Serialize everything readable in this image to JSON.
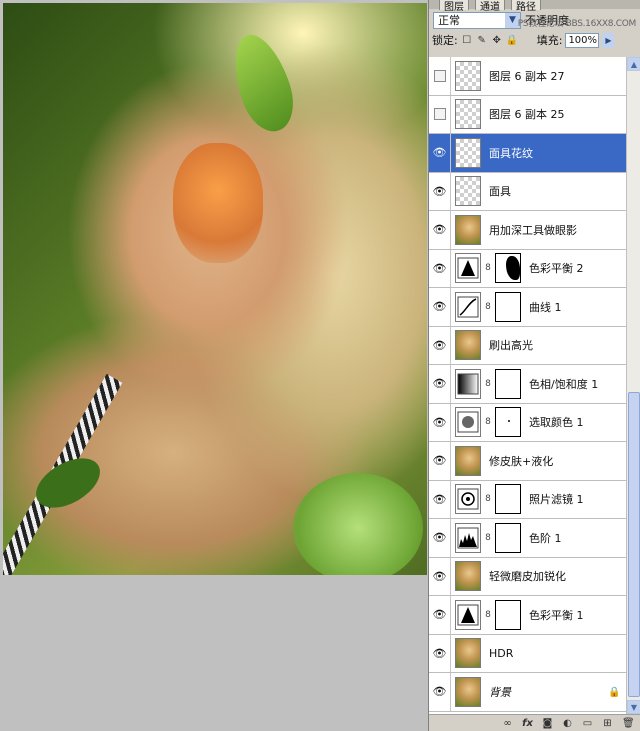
{
  "panel": {
    "tabs": [
      "图层",
      "通道",
      "路径"
    ],
    "blend_mode": "正常",
    "opacity_label": "不透明度",
    "watermark": "PS教程论坛 BBS.16XX8.COM",
    "lock_label": "锁定:",
    "fill_label": "填充:",
    "fill_value": "100%"
  },
  "layers": [
    {
      "name": "图层 6 副本 27",
      "visible": false,
      "thumb": "transparent"
    },
    {
      "name": "图层 6 副本 25",
      "visible": false,
      "thumb": "transparent"
    },
    {
      "name": "面具花纹",
      "visible": true,
      "thumb": "transparent",
      "selected": true
    },
    {
      "name": "面具",
      "visible": true,
      "thumb": "transparent"
    },
    {
      "name": "用加深工具做眼影",
      "visible": true,
      "thumb": "photo"
    },
    {
      "name": "色彩平衡 2",
      "visible": true,
      "thumb": "adj-balance",
      "mask": "black"
    },
    {
      "name": "曲线 1",
      "visible": true,
      "thumb": "adj-curves",
      "mask": "white"
    },
    {
      "name": "刷出高光",
      "visible": true,
      "thumb": "photo"
    },
    {
      "name": "色相/饱和度 1",
      "visible": true,
      "thumb": "adj-hue",
      "mask": "white"
    },
    {
      "name": "选取颜色 1",
      "visible": true,
      "thumb": "adj-selective",
      "mask": "dot"
    },
    {
      "name": "修皮肤+液化",
      "visible": true,
      "thumb": "photo"
    },
    {
      "name": "照片滤镜 1",
      "visible": true,
      "thumb": "adj-photofilter",
      "mask": "white"
    },
    {
      "name": "色阶 1",
      "visible": true,
      "thumb": "adj-levels",
      "mask": "white"
    },
    {
      "name": "轻微磨皮加锐化",
      "visible": true,
      "thumb": "photo"
    },
    {
      "name": "色彩平衡 1",
      "visible": true,
      "thumb": "adj-balance",
      "mask": "white"
    },
    {
      "name": "HDR",
      "visible": true,
      "thumb": "photo"
    },
    {
      "name": "背景",
      "visible": true,
      "thumb": "photo",
      "italic": true,
      "locked": true
    }
  ]
}
